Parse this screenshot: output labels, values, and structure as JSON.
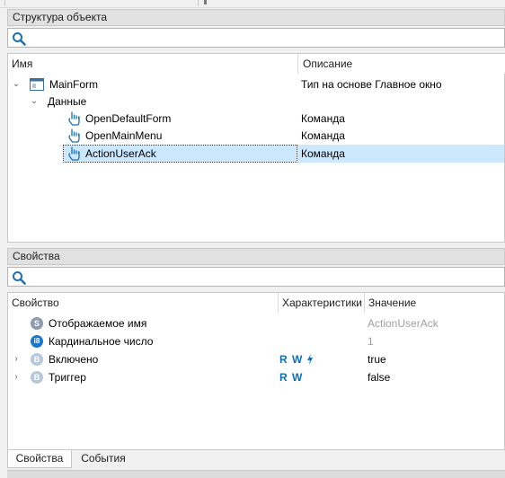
{
  "structure_panel": {
    "title": "Структура объекта",
    "columns": {
      "name": "Имя",
      "description": "Описание"
    },
    "tree": {
      "root": {
        "label": "MainForm",
        "description": "Тип на основе Главное окно"
      },
      "group": {
        "label": "Данные"
      },
      "items": [
        {
          "label": "OpenDefaultForm",
          "description": "Команда"
        },
        {
          "label": "OpenMainMenu",
          "description": "Команда"
        },
        {
          "label": "ActionUserAck",
          "description": "Команда"
        }
      ]
    }
  },
  "properties_panel": {
    "title": "Свойства",
    "columns": {
      "property": "Свойство",
      "characteristics": "Характеристики",
      "value": "Значение"
    },
    "rows": [
      {
        "icon": "S",
        "label": "Отображаемое имя",
        "chars": "",
        "value": "ActionUserAck"
      },
      {
        "icon": "i8",
        "label": "Кардинальное число",
        "chars": "",
        "value": "1"
      },
      {
        "icon": "B",
        "label": "Включено",
        "chars": "R W",
        "value": "true"
      },
      {
        "icon": "B",
        "label": "Триггер",
        "chars": "R W",
        "value": "false"
      }
    ]
  },
  "bottom_tabs": {
    "properties": "Свойства",
    "events": "События"
  },
  "colors": {
    "selection": "#cce8ff",
    "accent": "#0a70b8"
  }
}
